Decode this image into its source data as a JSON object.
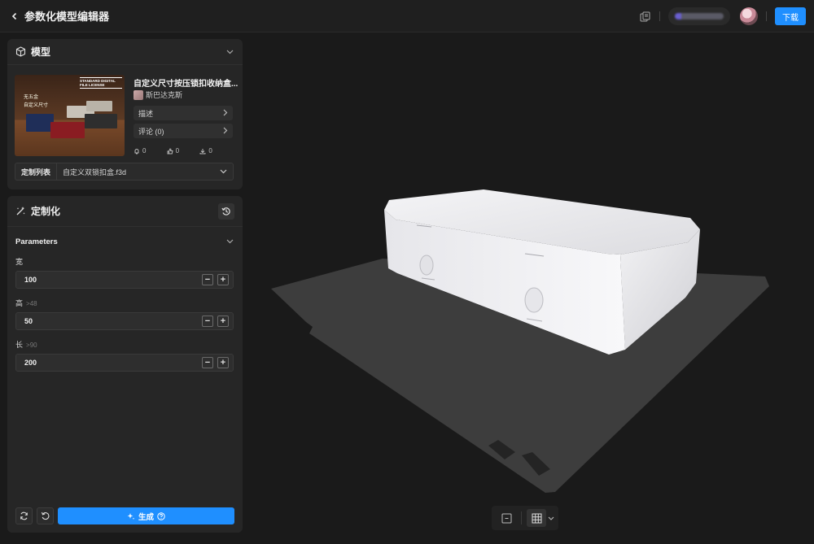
{
  "header": {
    "title": "参数化模型编辑器",
    "download_label": "下载"
  },
  "model_panel": {
    "title": "模型",
    "thumbnail": {
      "line1": "无五金",
      "line2": "自定义尺寸",
      "license": "STANDARD DIGITAL FILE LICENSE"
    },
    "name": "自定义尺寸按压锁扣收纳盒...",
    "author": "斯巴达克斯",
    "description_label": "描述",
    "comments_label": "评论 (0)",
    "stats": {
      "likes": "0",
      "thumbs": "0",
      "downloads": "0"
    },
    "custom_list_label": "定制列表",
    "custom_list_value": "自定义双锁扣盒.f3d"
  },
  "custom_panel": {
    "title": "定制化",
    "params_title": "Parameters",
    "params": [
      {
        "label": "宽",
        "hint": "",
        "value": "100"
      },
      {
        "label": "高",
        "hint": ">48",
        "value": "50"
      },
      {
        "label": "长",
        "hint": ">90",
        "value": "200"
      }
    ],
    "generate_label": "生成"
  },
  "colors": {
    "accent": "#1f8fff",
    "panel": "#262626",
    "background": "#1a1a1a"
  }
}
